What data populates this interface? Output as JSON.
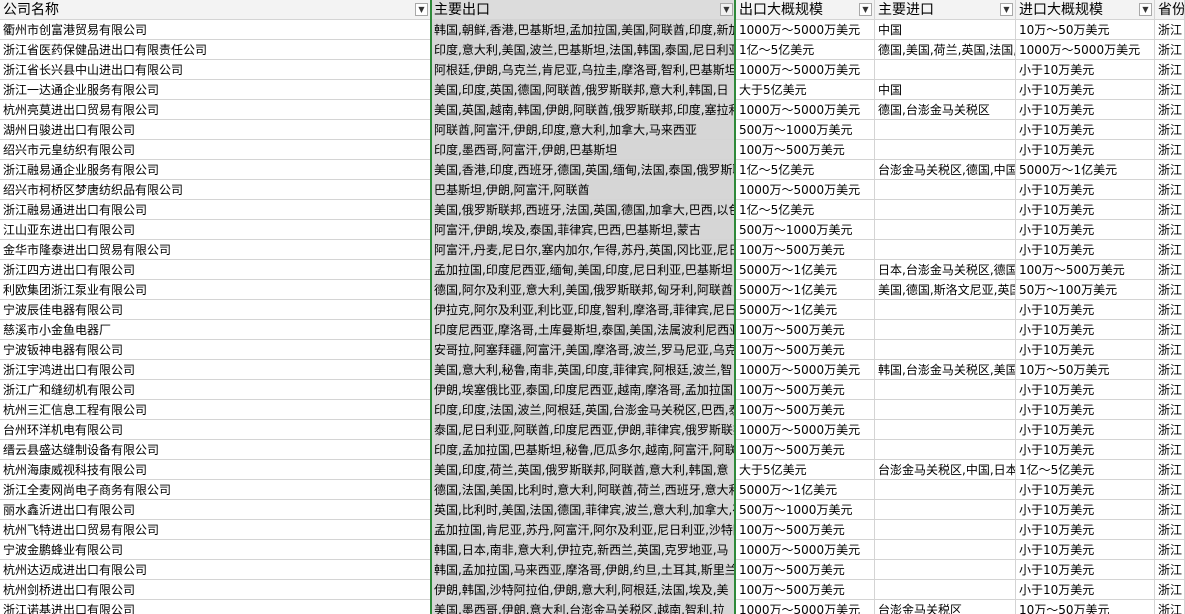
{
  "headers": [
    {
      "label": "公司名称",
      "filter": "▼"
    },
    {
      "label": "主要出口",
      "filter": "▼"
    },
    {
      "label": "出口大概规模",
      "filter": "▼"
    },
    {
      "label": "主要进口",
      "filter": "▼"
    },
    {
      "label": "进口大概规模",
      "filter": "▼"
    },
    {
      "label": "省份",
      "filter": ""
    }
  ],
  "rows": [
    [
      "衢州市创富港贸易有限公司",
      "韩国,朝鲜,香港,巴基斯坦,孟加拉国,美国,阿联酋,印度,新加",
      "1000万～5000万美元",
      "中国",
      "10万～50万美元",
      "浙江"
    ],
    [
      "浙江省医药保健品进出口有限责任公司",
      "印度,意大利,美国,波兰,巴基斯坦,法国,韩国,泰国,尼日利亚,",
      "1亿～5亿美元",
      "德国,美国,荷兰,英国,法国,",
      "1000万～5000万美元",
      "浙江"
    ],
    [
      "浙江省长兴县中山进出口有限公司",
      "阿根廷,伊朗,乌克兰,肯尼亚,乌拉圭,摩洛哥,智利,巴基斯坦,",
      "1000万～5000万美元",
      "",
      "小于10万美元",
      "浙江"
    ],
    [
      "浙江一达通企业服务有限公司",
      "美国,印度,英国,德国,阿联酋,俄罗斯联邦,意大利,韩国,日",
      "大于5亿美元",
      "中国",
      "小于10万美元",
      "浙江"
    ],
    [
      "杭州亮莫进出口贸易有限公司",
      "美国,英国,越南,韩国,伊朗,阿联酋,俄罗斯联邦,印度,塞拉利",
      "1000万～5000万美元",
      "德国,台澎金马关税区",
      "小于10万美元",
      "浙江"
    ],
    [
      "湖州日骏进出口有限公司",
      "阿联酋,阿富汗,伊朗,印度,意大利,加拿大,马来西亚",
      "500万～1000万美元",
      "",
      "小于10万美元",
      "浙江"
    ],
    [
      "绍兴市元皇纺织有限公司",
      "印度,墨西哥,阿富汗,伊朗,巴基斯坦",
      "100万～500万美元",
      "",
      "小于10万美元",
      "浙江"
    ],
    [
      "浙江融易通企业服务有限公司",
      "美国,香港,印度,西班牙,德国,英国,缅甸,法国,泰国,俄罗斯联",
      "1亿～5亿美元",
      "台澎金马关税区,德国,中国",
      "5000万～1亿美元",
      "浙江"
    ],
    [
      "绍兴市柯桥区梦唐纺织品有限公司",
      "巴基斯坦,伊朗,阿富汗,阿联酋",
      "1000万～5000万美元",
      "",
      "小于10万美元",
      "浙江"
    ],
    [
      "浙江融易通进出口有限公司",
      "美国,俄罗斯联邦,西班牙,法国,英国,德国,加拿大,巴西,以色",
      "1亿～5亿美元",
      "",
      "小于10万美元",
      "浙江"
    ],
    [
      "江山亚东进出口有限公司",
      "阿富汗,伊朗,埃及,泰国,菲律宾,巴西,巴基斯坦,蒙古",
      "500万～1000万美元",
      "",
      "小于10万美元",
      "浙江"
    ],
    [
      "金华市隆泰进出口贸易有限公司",
      "阿富汗,丹麦,尼日尔,塞内加尔,乍得,苏丹,英国,冈比亚,尼日",
      "100万～500万美元",
      "",
      "小于10万美元",
      "浙江"
    ],
    [
      "浙江四方进出口有限公司",
      "孟加拉国,印度尼西亚,缅甸,美国,印度,尼日利亚,巴基斯坦,",
      "5000万～1亿美元",
      "日本,台澎金马关税区,德国",
      "100万～500万美元",
      "浙江"
    ],
    [
      "利欧集团浙江泵业有限公司",
      "德国,阿尔及利亚,意大利,美国,俄罗斯联邦,匈牙利,阿联酋,",
      "5000万～1亿美元",
      "美国,德国,斯洛文尼亚,英国",
      "50万～100万美元",
      "浙江"
    ],
    [
      "宁波辰佳电器有限公司",
      "伊拉克,阿尔及利亚,利比亚,印度,智利,摩洛哥,菲律宾,尼日",
      "5000万～1亿美元",
      "",
      "小于10万美元",
      "浙江"
    ],
    [
      "慈溪市小金鱼电器厂",
      "印度尼西亚,摩洛哥,土库曼斯坦,泰国,美国,法属波利尼西亚",
      "100万～500万美元",
      "",
      "小于10万美元",
      "浙江"
    ],
    [
      "宁波钣神电器有限公司",
      "安哥拉,阿塞拜疆,阿富汗,美国,摩洛哥,波兰,罗马尼亚,乌克",
      "100万～500万美元",
      "",
      "小于10万美元",
      "浙江"
    ],
    [
      "浙江宇鸿进出口有限公司",
      "美国,意大利,秘鲁,南非,英国,印度,菲律宾,阿根廷,波兰,智",
      "1000万～5000万美元",
      "韩国,台澎金马关税区,美国",
      "10万～50万美元",
      "浙江"
    ],
    [
      "浙江广和缝纫机有限公司",
      "伊朗,埃塞俄比亚,泰国,印度尼西亚,越南,摩洛哥,孟加拉国,",
      "100万～500万美元",
      "",
      "小于10万美元",
      "浙江"
    ],
    [
      "杭州三汇信息工程有限公司",
      "印度,印度,法国,波兰,阿根廷,英国,台澎金马关税区,巴西,泰",
      "100万～500万美元",
      "",
      "小于10万美元",
      "浙江"
    ],
    [
      "台州环洋机电有限公司",
      "泰国,尼日利亚,阿联酋,印度尼西亚,伊朗,菲律宾,俄罗斯联邦",
      "1000万～5000万美元",
      "",
      "小于10万美元",
      "浙江"
    ],
    [
      "缙云县盛达缝制设备有限公司",
      "印度,孟加拉国,巴基斯坦,秘鲁,厄瓜多尔,越南,阿富汗,阿联",
      "100万～500万美元",
      "",
      "小于10万美元",
      "浙江"
    ],
    [
      "杭州海康威视科技有限公司",
      "美国,印度,荷兰,英国,俄罗斯联邦,阿联酋,意大利,韩国,意",
      "大于5亿美元",
      "台澎金马关税区,中国,日本",
      "1亿～5亿美元",
      "浙江"
    ],
    [
      "浙江全麦网尚电子商务有限公司",
      "德国,法国,美国,比利时,意大利,阿联酋,荷兰,西班牙,意大利,",
      "5000万～1亿美元",
      "",
      "小于10万美元",
      "浙江"
    ],
    [
      "丽水鑫沂进出口有限公司",
      "英国,比利时,美国,法国,德国,菲律宾,波兰,意大利,加拿大,荷",
      "500万～1000万美元",
      "",
      "小于10万美元",
      "浙江"
    ],
    [
      "杭州飞特进出口贸易有限公司",
      "孟加拉国,肯尼亚,苏丹,阿富汗,阿尔及利亚,尼日利亚,沙特阿",
      "100万～500万美元",
      "",
      "小于10万美元",
      "浙江"
    ],
    [
      "宁波金鹏蜂业有限公司",
      "韩国,日本,南非,意大利,伊拉克,新西兰,英国,克罗地亚,马",
      "1000万～5000万美元",
      "",
      "小于10万美元",
      "浙江"
    ],
    [
      "杭州达迈成进出口有限公司",
      "韩国,孟加拉国,马来西亚,摩洛哥,伊朗,约旦,土耳其,斯里兰",
      "100万～500万美元",
      "",
      "小于10万美元",
      "浙江"
    ],
    [
      "杭州剑桥进出口有限公司",
      "伊朗,韩国,沙特阿拉伯,伊朗,意大利,阿根廷,法国,埃及,美",
      "100万～500万美元",
      "",
      "小于10万美元",
      "浙江"
    ],
    [
      "浙江诺基进出口有限公司",
      "美国,墨西哥,伊朗,意大利,台澎金马关税区,越南,智利,拉",
      "1000万～5000万美元",
      "台澎金马关税区",
      "10万～50万美元",
      "浙江"
    ]
  ]
}
